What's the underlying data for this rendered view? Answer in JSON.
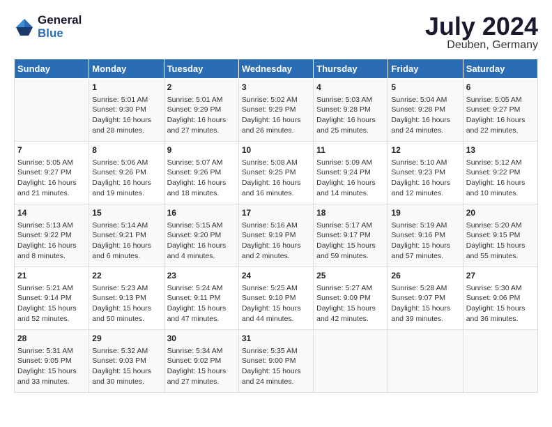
{
  "header": {
    "logo_line1": "General",
    "logo_line2": "Blue",
    "month_year": "July 2024",
    "location": "Deuben, Germany"
  },
  "days_of_week": [
    "Sunday",
    "Monday",
    "Tuesday",
    "Wednesday",
    "Thursday",
    "Friday",
    "Saturday"
  ],
  "weeks": [
    [
      {
        "day": "",
        "content": ""
      },
      {
        "day": "1",
        "content": "Sunrise: 5:01 AM\nSunset: 9:30 PM\nDaylight: 16 hours\nand 28 minutes."
      },
      {
        "day": "2",
        "content": "Sunrise: 5:01 AM\nSunset: 9:29 PM\nDaylight: 16 hours\nand 27 minutes."
      },
      {
        "day": "3",
        "content": "Sunrise: 5:02 AM\nSunset: 9:29 PM\nDaylight: 16 hours\nand 26 minutes."
      },
      {
        "day": "4",
        "content": "Sunrise: 5:03 AM\nSunset: 9:28 PM\nDaylight: 16 hours\nand 25 minutes."
      },
      {
        "day": "5",
        "content": "Sunrise: 5:04 AM\nSunset: 9:28 PM\nDaylight: 16 hours\nand 24 minutes."
      },
      {
        "day": "6",
        "content": "Sunrise: 5:05 AM\nSunset: 9:27 PM\nDaylight: 16 hours\nand 22 minutes."
      }
    ],
    [
      {
        "day": "7",
        "content": "Sunrise: 5:05 AM\nSunset: 9:27 PM\nDaylight: 16 hours\nand 21 minutes."
      },
      {
        "day": "8",
        "content": "Sunrise: 5:06 AM\nSunset: 9:26 PM\nDaylight: 16 hours\nand 19 minutes."
      },
      {
        "day": "9",
        "content": "Sunrise: 5:07 AM\nSunset: 9:26 PM\nDaylight: 16 hours\nand 18 minutes."
      },
      {
        "day": "10",
        "content": "Sunrise: 5:08 AM\nSunset: 9:25 PM\nDaylight: 16 hours\nand 16 minutes."
      },
      {
        "day": "11",
        "content": "Sunrise: 5:09 AM\nSunset: 9:24 PM\nDaylight: 16 hours\nand 14 minutes."
      },
      {
        "day": "12",
        "content": "Sunrise: 5:10 AM\nSunset: 9:23 PM\nDaylight: 16 hours\nand 12 minutes."
      },
      {
        "day": "13",
        "content": "Sunrise: 5:12 AM\nSunset: 9:22 PM\nDaylight: 16 hours\nand 10 minutes."
      }
    ],
    [
      {
        "day": "14",
        "content": "Sunrise: 5:13 AM\nSunset: 9:22 PM\nDaylight: 16 hours\nand 8 minutes."
      },
      {
        "day": "15",
        "content": "Sunrise: 5:14 AM\nSunset: 9:21 PM\nDaylight: 16 hours\nand 6 minutes."
      },
      {
        "day": "16",
        "content": "Sunrise: 5:15 AM\nSunset: 9:20 PM\nDaylight: 16 hours\nand 4 minutes."
      },
      {
        "day": "17",
        "content": "Sunrise: 5:16 AM\nSunset: 9:19 PM\nDaylight: 16 hours\nand 2 minutes."
      },
      {
        "day": "18",
        "content": "Sunrise: 5:17 AM\nSunset: 9:17 PM\nDaylight: 15 hours\nand 59 minutes."
      },
      {
        "day": "19",
        "content": "Sunrise: 5:19 AM\nSunset: 9:16 PM\nDaylight: 15 hours\nand 57 minutes."
      },
      {
        "day": "20",
        "content": "Sunrise: 5:20 AM\nSunset: 9:15 PM\nDaylight: 15 hours\nand 55 minutes."
      }
    ],
    [
      {
        "day": "21",
        "content": "Sunrise: 5:21 AM\nSunset: 9:14 PM\nDaylight: 15 hours\nand 52 minutes."
      },
      {
        "day": "22",
        "content": "Sunrise: 5:23 AM\nSunset: 9:13 PM\nDaylight: 15 hours\nand 50 minutes."
      },
      {
        "day": "23",
        "content": "Sunrise: 5:24 AM\nSunset: 9:11 PM\nDaylight: 15 hours\nand 47 minutes."
      },
      {
        "day": "24",
        "content": "Sunrise: 5:25 AM\nSunset: 9:10 PM\nDaylight: 15 hours\nand 44 minutes."
      },
      {
        "day": "25",
        "content": "Sunrise: 5:27 AM\nSunset: 9:09 PM\nDaylight: 15 hours\nand 42 minutes."
      },
      {
        "day": "26",
        "content": "Sunrise: 5:28 AM\nSunset: 9:07 PM\nDaylight: 15 hours\nand 39 minutes."
      },
      {
        "day": "27",
        "content": "Sunrise: 5:30 AM\nSunset: 9:06 PM\nDaylight: 15 hours\nand 36 minutes."
      }
    ],
    [
      {
        "day": "28",
        "content": "Sunrise: 5:31 AM\nSunset: 9:05 PM\nDaylight: 15 hours\nand 33 minutes."
      },
      {
        "day": "29",
        "content": "Sunrise: 5:32 AM\nSunset: 9:03 PM\nDaylight: 15 hours\nand 30 minutes."
      },
      {
        "day": "30",
        "content": "Sunrise: 5:34 AM\nSunset: 9:02 PM\nDaylight: 15 hours\nand 27 minutes."
      },
      {
        "day": "31",
        "content": "Sunrise: 5:35 AM\nSunset: 9:00 PM\nDaylight: 15 hours\nand 24 minutes."
      },
      {
        "day": "",
        "content": ""
      },
      {
        "day": "",
        "content": ""
      },
      {
        "day": "",
        "content": ""
      }
    ]
  ]
}
